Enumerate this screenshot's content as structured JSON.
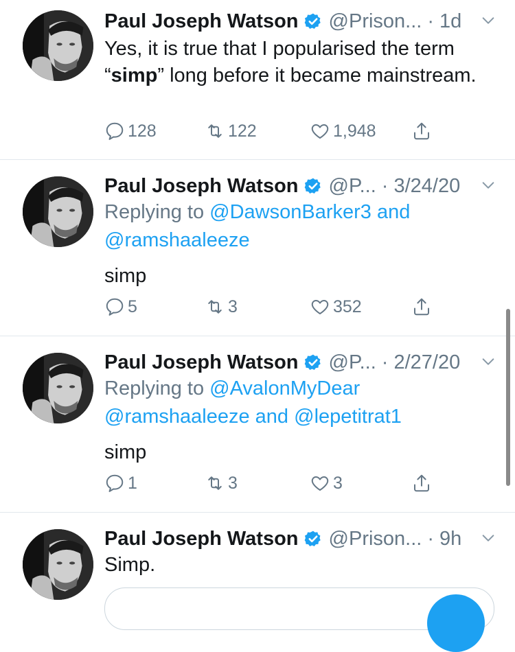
{
  "tweets": [
    {
      "name": "Paul Joseph Watson",
      "handle": "@Prison...",
      "time": "· 1d",
      "text_parts": [
        "Yes, it is true that I popularised the term “",
        "simp",
        "” long before it became mainstream."
      ],
      "replies": "128",
      "retweets": "122",
      "likes": "1,948"
    },
    {
      "name": "Paul Joseph Watson",
      "handle": "@P...",
      "time": "· 3/24/20",
      "replying_prefix": "Replying to",
      "mention_1": "@DawsonBarker3",
      "mention_joiner": "and",
      "mention_2": "@ramshaaleeze",
      "text": "simp",
      "replies": "5",
      "retweets": "3",
      "likes": "352"
    },
    {
      "name": "Paul Joseph Watson",
      "handle": "@P...",
      "time": "· 2/27/20",
      "replying_prefix": "Replying to",
      "mention_1": "@AvalonMyDear",
      "mention_2": "@ramshaaleeze",
      "mention_joiner": "and",
      "mention_3": "@lepetitrat1",
      "text": "simp",
      "replies": "1",
      "retweets": "3",
      "likes": "3"
    },
    {
      "name": "Paul Joseph Watson",
      "handle": "@Prison...",
      "time": "· 9h",
      "text": "Simp."
    }
  ],
  "colors": {
    "accent": "#1da1f2",
    "muted": "#657786",
    "text": "#14171a",
    "divider": "#e1e8ed"
  }
}
